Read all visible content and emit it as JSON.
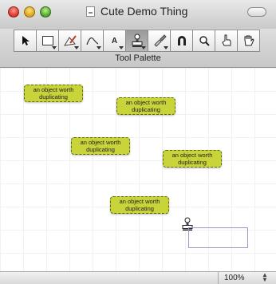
{
  "window": {
    "title": "Cute Demo Thing"
  },
  "palette": {
    "label": "Tool Palette",
    "tools": [
      {
        "name": "arrow",
        "glyph": "➤"
      },
      {
        "name": "rectangle",
        "glyph": "▭"
      },
      {
        "name": "pen",
        "glyph": "✎"
      },
      {
        "name": "curve",
        "glyph": "⌒"
      },
      {
        "name": "text",
        "glyph": "A"
      },
      {
        "name": "stamp",
        "glyph": "⎔"
      },
      {
        "name": "brush",
        "glyph": "✐"
      },
      {
        "name": "magnet",
        "glyph": "∩"
      },
      {
        "name": "zoom",
        "glyph": "⌕"
      },
      {
        "name": "pointing-hand",
        "glyph": "☝"
      },
      {
        "name": "grab-hand",
        "glyph": "✋"
      }
    ]
  },
  "canvas": {
    "objects": [
      {
        "text": "an object worth duplicating"
      },
      {
        "text": "an object worth duplicating"
      },
      {
        "text": "an object worth duplicating"
      },
      {
        "text": "an object worth duplicating"
      },
      {
        "text": "an object worth duplicating"
      }
    ]
  },
  "status": {
    "zoom": "100%"
  },
  "colors": {
    "object_fill": "#c9d43a",
    "object_border": "#5a6a10"
  }
}
